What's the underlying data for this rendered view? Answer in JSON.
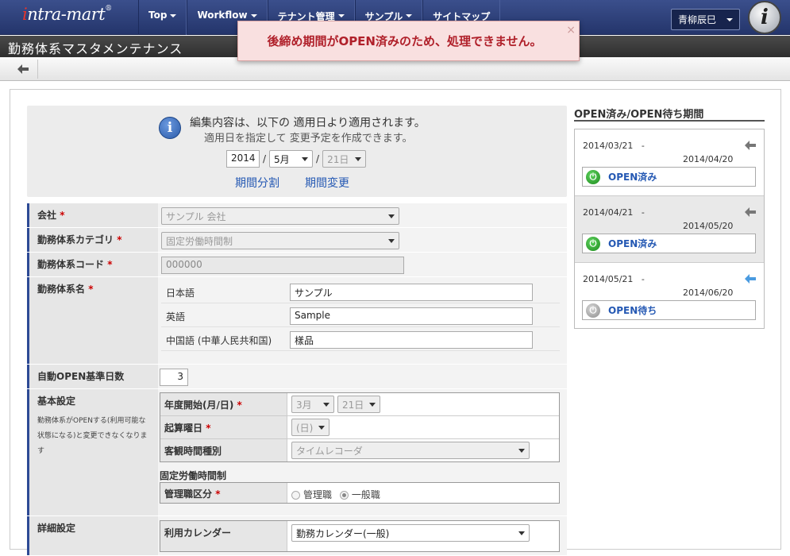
{
  "header": {
    "logo": {
      "prefix": "i",
      "text": "ntra-mart",
      "mark": "®"
    },
    "menu": [
      "Top",
      "Workflow",
      "テナント管理",
      "サンプル",
      "サイトマップ"
    ],
    "user_name": "青柳辰巳",
    "brand_icon": "i"
  },
  "page_title": "勤務体系マスタメンテナンス",
  "toast": {
    "message": "後締め期間がOPEN済みのため、処理できません。",
    "close": "×"
  },
  "notice": {
    "line1": "編集内容は、以下の 適用日より適用されます。",
    "line2": "適用日を指定して 変更予定を作成できます。",
    "year": "2014",
    "month": "5月",
    "day": "21日",
    "sep": "/",
    "link_split": "期間分割",
    "link_change": "期間変更"
  },
  "form": {
    "company": {
      "label": "会社",
      "value": "サンプル 会社"
    },
    "category": {
      "label": "勤務体系カテゴリ",
      "value": "固定労働時間制"
    },
    "code": {
      "label": "勤務体系コード",
      "value": "000000"
    },
    "name": {
      "label": "勤務体系名",
      "langs": [
        {
          "lang": "日本語",
          "value": "サンプル"
        },
        {
          "lang": "英語",
          "value": "Sample"
        },
        {
          "lang": "中国語 (中華人民共和国)",
          "value": "樣品"
        }
      ]
    },
    "auto_open": {
      "label": "自動OPEN基準日数",
      "value": "3"
    },
    "basic": {
      "label": "基本設定",
      "note": "勤務体系がOPENする(利用可能な状態になる)と変更できなくなります",
      "fiscal_start": {
        "label": "年度開始(月/日)",
        "month": "3月",
        "day": "21日"
      },
      "week_start": {
        "label": "起算曜日",
        "value": "(日)"
      },
      "time_type": {
        "label": "客観時間種別",
        "value": "タイムレコーダ"
      },
      "section_title": "固定労働時間制",
      "manager": {
        "label": "管理職区分",
        "options": [
          "管理職",
          "一般職"
        ],
        "selected": "一般職"
      }
    },
    "detail": {
      "label": "詳細設定",
      "calendar": {
        "label": "利用カレンダー",
        "value": "勤務カレンダー(一般)"
      }
    }
  },
  "sidebar": {
    "title": "OPEN済み/OPEN待ち期間",
    "periods": [
      {
        "start": "2014/03/21",
        "dash": "-",
        "end": "2014/04/20",
        "status": "OPEN済み"
      },
      {
        "start": "2014/04/21",
        "dash": "-",
        "end": "2014/05/20",
        "status": "OPEN済み"
      },
      {
        "start": "2014/05/21",
        "dash": "-",
        "end": "2014/06/20",
        "status": "OPEN待ち"
      }
    ]
  },
  "colors": {
    "accent": "#2d4a95",
    "link": "#2458b3",
    "error": "#b0202a",
    "current_arrow": "#4a9be0"
  }
}
